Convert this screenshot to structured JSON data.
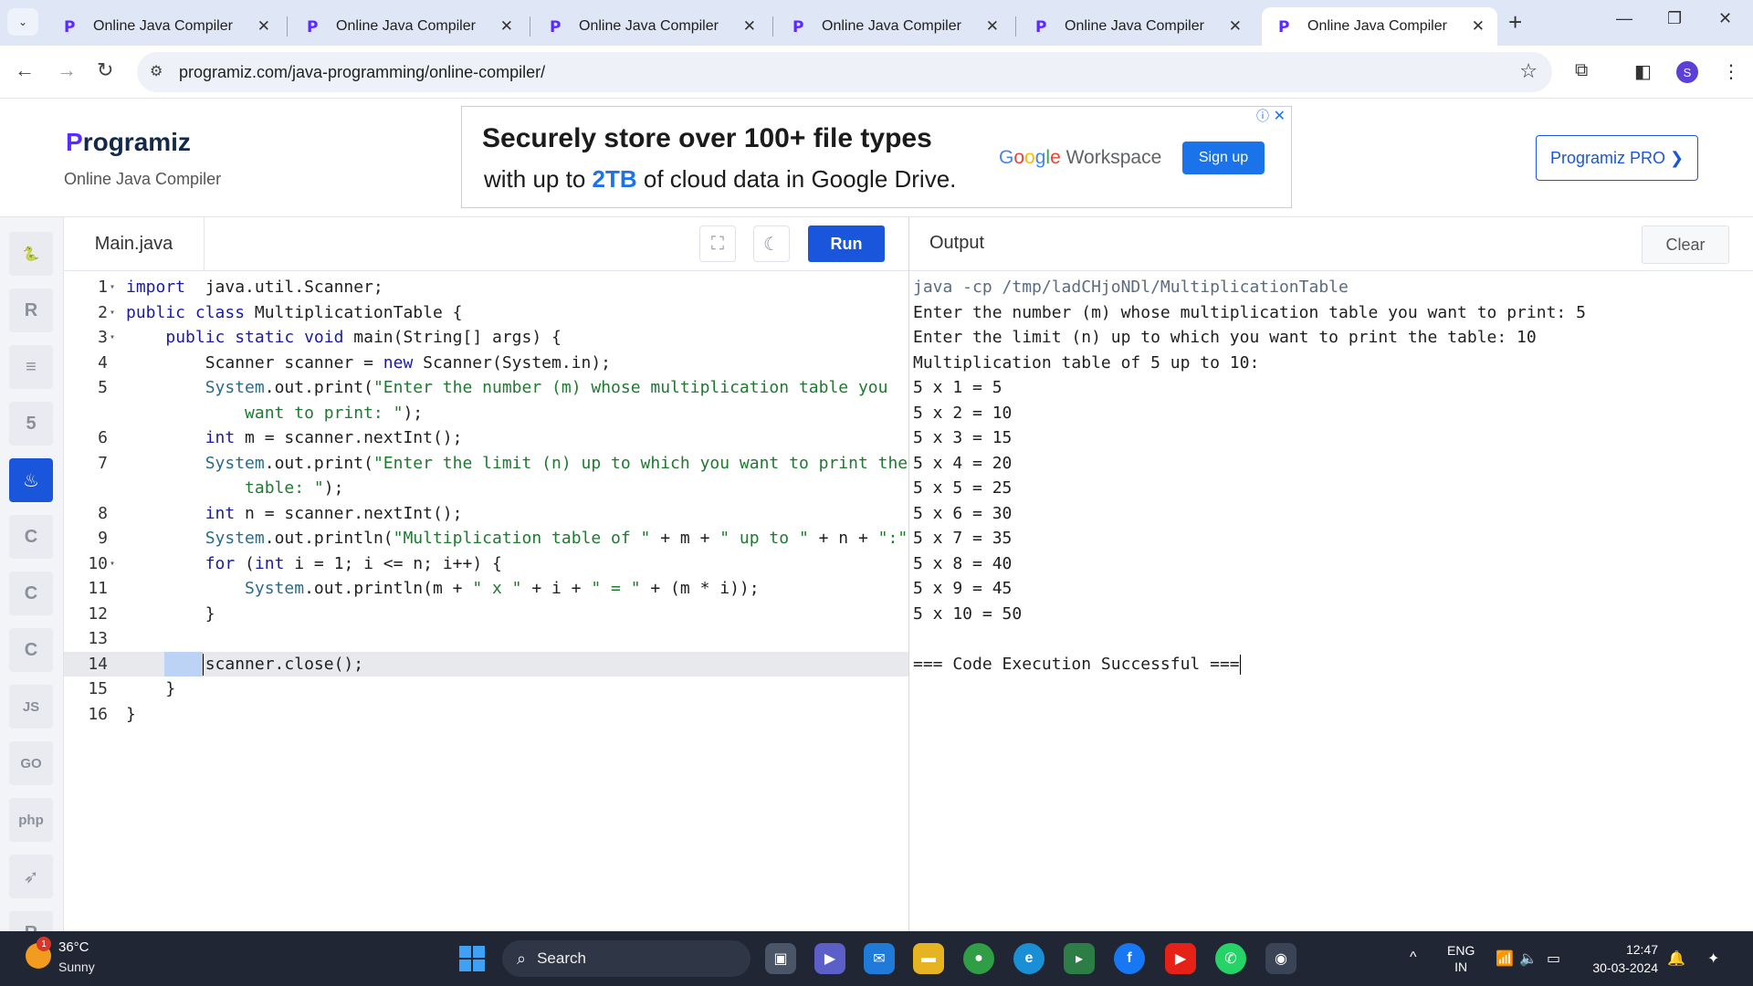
{
  "browser": {
    "tabs": [
      {
        "title": "Online Java Compiler",
        "active": false
      },
      {
        "title": "Online Java Compiler",
        "active": false
      },
      {
        "title": "Online Java Compiler",
        "active": false
      },
      {
        "title": "Online Java Compiler",
        "active": false
      },
      {
        "title": "Online Java Compiler",
        "active": false
      },
      {
        "title": "Online Java Compiler",
        "active": true
      }
    ],
    "url": "programiz.com/java-programming/online-compiler/",
    "profile_initial": "S"
  },
  "site": {
    "brand": "rogramiz",
    "brand_initial": "P",
    "subtitle": "Online Java Compiler",
    "pro_button": "Programiz PRO ❯"
  },
  "ad": {
    "line1": "Securely  store over 100+ file types",
    "line2_pre": "with up to ",
    "line2_hl": "2TB",
    "line2_post": " of cloud data in Google Drive.",
    "brand_google": "Google",
    "brand_product": " Workspace",
    "cta": "Sign up"
  },
  "sidebar": {
    "languages": [
      {
        "name": "python",
        "glyph": "🐍"
      },
      {
        "name": "r",
        "glyph": "R"
      },
      {
        "name": "sql",
        "glyph": "≡"
      },
      {
        "name": "html",
        "glyph": "5"
      },
      {
        "name": "java",
        "glyph": "♨"
      },
      {
        "name": "c",
        "glyph": "C"
      },
      {
        "name": "csharp",
        "glyph": "C"
      },
      {
        "name": "cpp",
        "glyph": "C"
      },
      {
        "name": "js",
        "glyph": "JS"
      },
      {
        "name": "go",
        "glyph": "GO"
      },
      {
        "name": "php",
        "glyph": "php"
      },
      {
        "name": "swift",
        "glyph": "➶"
      },
      {
        "name": "rust",
        "glyph": "R"
      }
    ],
    "active_index": 4
  },
  "editor": {
    "filename": "Main.java",
    "run_label": "Run",
    "lines": [
      {
        "num": "1",
        "fold": true,
        "segments": [
          [
            "kw",
            "import"
          ],
          [
            "",
            "  java.util.Scanner;"
          ]
        ]
      },
      {
        "num": "2",
        "fold": true,
        "segments": [
          [
            "kw",
            "public class"
          ],
          [
            "",
            " MultiplicationTable {"
          ]
        ]
      },
      {
        "num": "3",
        "fold": true,
        "segments": [
          [
            "",
            "    "
          ],
          [
            "kw",
            "public static void"
          ],
          [
            "",
            " main(String[] args) {"
          ]
        ]
      },
      {
        "num": "4",
        "fold": false,
        "segments": [
          [
            "",
            "        Scanner scanner = "
          ],
          [
            "kw",
            "new"
          ],
          [
            "",
            " Scanner(System.in);"
          ]
        ]
      },
      {
        "num": "5",
        "fold": false,
        "segments": [
          [
            "",
            "        "
          ],
          [
            "cls",
            "System"
          ],
          [
            "",
            ".out.print("
          ],
          [
            "str",
            "\"Enter the number (m) whose multiplication table you"
          ]
        ]
      },
      {
        "num": "",
        "fold": false,
        "segments": [
          [
            "str",
            "            want to print: \""
          ],
          [
            "",
            ");"
          ]
        ]
      },
      {
        "num": "6",
        "fold": false,
        "segments": [
          [
            "",
            "        "
          ],
          [
            "kw",
            "int"
          ],
          [
            "",
            " m = scanner.nextInt();"
          ]
        ]
      },
      {
        "num": "7",
        "fold": false,
        "segments": [
          [
            "",
            "        "
          ],
          [
            "cls",
            "System"
          ],
          [
            "",
            ".out.print("
          ],
          [
            "str",
            "\"Enter the limit (n) up to which you want to print the"
          ]
        ]
      },
      {
        "num": "",
        "fold": false,
        "segments": [
          [
            "str",
            "            table: \""
          ],
          [
            "",
            ");"
          ]
        ]
      },
      {
        "num": "8",
        "fold": false,
        "segments": [
          [
            "",
            "        "
          ],
          [
            "kw",
            "int"
          ],
          [
            "",
            " n = scanner.nextInt();"
          ]
        ]
      },
      {
        "num": "9",
        "fold": false,
        "segments": [
          [
            "",
            "        "
          ],
          [
            "cls",
            "System"
          ],
          [
            "",
            ".out.println("
          ],
          [
            "str",
            "\"Multiplication table of \""
          ],
          [
            "",
            " + m + "
          ],
          [
            "str",
            "\" up to \""
          ],
          [
            "",
            " + n + "
          ],
          [
            "str",
            "\":\""
          ],
          [
            "",
            ");"
          ]
        ]
      },
      {
        "num": "10",
        "fold": true,
        "segments": [
          [
            "",
            "        "
          ],
          [
            "kw",
            "for"
          ],
          [
            "",
            " ("
          ],
          [
            "kw",
            "int"
          ],
          [
            "",
            " i = 1; i <= n; i++) {"
          ]
        ]
      },
      {
        "num": "11",
        "fold": false,
        "segments": [
          [
            "",
            "            "
          ],
          [
            "cls",
            "System"
          ],
          [
            "",
            ".out.println(m + "
          ],
          [
            "str",
            "\" x \""
          ],
          [
            "",
            " + i + "
          ],
          [
            "str",
            "\" = \""
          ],
          [
            "",
            " + (m * i));"
          ]
        ]
      },
      {
        "num": "12",
        "fold": false,
        "segments": [
          [
            "",
            "        }"
          ]
        ]
      },
      {
        "num": "13",
        "fold": false,
        "segments": [
          [
            "",
            ""
          ]
        ]
      },
      {
        "num": "14",
        "fold": false,
        "segments": [
          [
            "",
            "        scanner.close();"
          ]
        ],
        "highlight": true
      },
      {
        "num": "15",
        "fold": false,
        "segments": [
          [
            "",
            "    }"
          ]
        ]
      },
      {
        "num": "16",
        "fold": false,
        "segments": [
          [
            "",
            "}"
          ]
        ]
      }
    ]
  },
  "output": {
    "title": "Output",
    "clear_label": "Clear",
    "command": "java -cp /tmp/ladCHjoNDl/MultiplicationTable",
    "lines": [
      "Enter the number (m) whose multiplication table you want to print: 5",
      "Enter the limit (n) up to which you want to print the table: 10",
      "Multiplication table of 5 up to 10:",
      "5 x 1 = 5",
      "5 x 2 = 10",
      "5 x 3 = 15",
      "5 x 4 = 20",
      "5 x 5 = 25",
      "5 x 6 = 30",
      "5 x 7 = 35",
      "5 x 8 = 40",
      "5 x 9 = 45",
      "5 x 10 = 50",
      "",
      "=== Code Execution Successful ==="
    ]
  },
  "taskbar": {
    "temperature": "36°C",
    "weather": "Sunny",
    "weather_badge": "1",
    "search_placeholder": "Search",
    "lang_line1": "ENG",
    "lang_line2": "IN",
    "time": "12:47",
    "date": "30-03-2024"
  }
}
